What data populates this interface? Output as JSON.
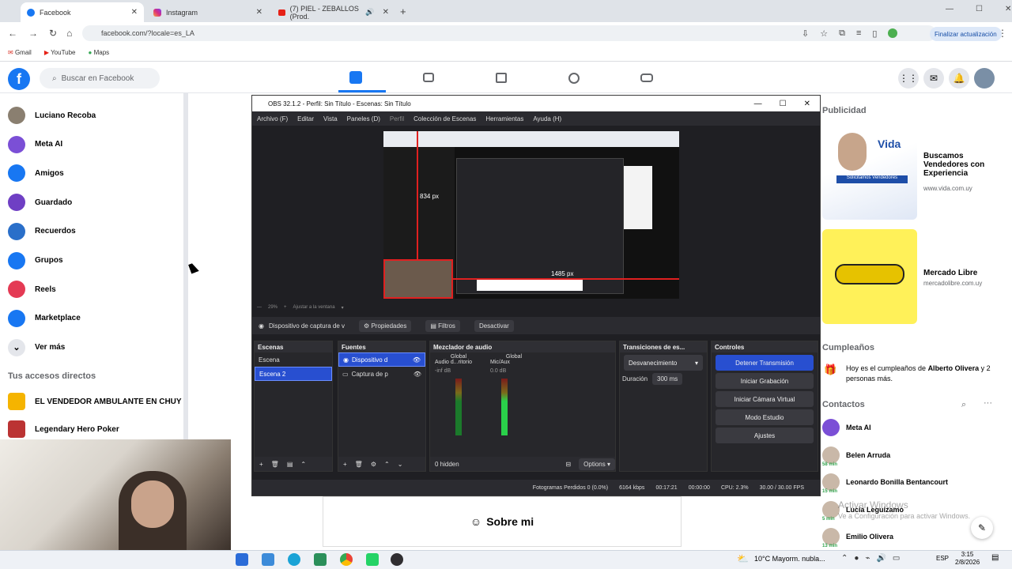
{
  "browser": {
    "tabs": [
      {
        "label": "Facebook",
        "active": true
      },
      {
        "label": "Instagram",
        "active": false
      },
      {
        "label": "(7) PIEL - ZEBALLOS (Prod.",
        "active": false
      }
    ],
    "url": "facebook.com/?locale=es_LA",
    "update_button": "Finalizar actualización",
    "bookmarks": [
      "Gmail",
      "YouTube",
      "Maps"
    ]
  },
  "facebook": {
    "search_placeholder": "Buscar en Facebook",
    "left_nav": [
      {
        "label": "Luciano Recoba",
        "icon": "avatar",
        "color": "#8a7f70"
      },
      {
        "label": "Meta AI",
        "icon": "meta-ai-icon",
        "color": "#7b4fd6"
      },
      {
        "label": "Amigos",
        "icon": "friends-icon",
        "color": "#1877f2"
      },
      {
        "label": "Guardado",
        "icon": "bookmark-icon",
        "color": "#6f3fc4"
      },
      {
        "label": "Recuerdos",
        "icon": "clock-icon",
        "color": "#2a6fc9"
      },
      {
        "label": "Grupos",
        "icon": "groups-icon",
        "color": "#1877f2"
      },
      {
        "label": "Reels",
        "icon": "reels-icon",
        "color": "#e43a54"
      },
      {
        "label": "Marketplace",
        "icon": "marketplace-icon",
        "color": "#1877f2"
      },
      {
        "label": "Ver más",
        "icon": "chevron-down-icon",
        "color": "#e4e6eb"
      }
    ],
    "shortcuts_title": "Tus accesos directos",
    "shortcuts": [
      {
        "label": "EL VENDEDOR AMBULANTE EN CHUY"
      },
      {
        "label": "Legendary Hero Poker"
      }
    ],
    "ads_title": "Publicidad",
    "ads": [
      {
        "title": "Buscamos Vendedores con Experiencia",
        "domain": "www.vida.com.uy",
        "banner": "Solicitamos Vendedores",
        "brand": "Vida"
      },
      {
        "title": "Mercado Libre",
        "domain": "mercadolibre.com.uy"
      }
    ],
    "birthdays_title": "Cumpleaños",
    "birthday_text_pre": "Hoy es el cumpleaños de ",
    "birthday_name": "Alberto Olivera",
    "birthday_text_post": " y 2 personas más.",
    "contacts_title": "Contactos",
    "contacts": [
      {
        "name": "Meta AI",
        "badge": ""
      },
      {
        "name": "Belen Arruda",
        "badge": "58 min"
      },
      {
        "name": "Leonardo Bonilla Bentancourt",
        "badge": "15 min"
      },
      {
        "name": "Lucia Leguizamo",
        "badge": "5 min"
      },
      {
        "name": "Emilio Olivera",
        "badge": "13 min"
      }
    ],
    "sobre_mi": "Sobre mi"
  },
  "obs": {
    "title": "OBS 32.1.2 - Perfil: Sin Título - Escenas: Sin Título",
    "menu": [
      "Archivo (F)",
      "Editar",
      "Vista",
      "Paneles (D)",
      "Perfil",
      "Colección de Escenas",
      "Herramientas",
      "Ayuda (H)"
    ],
    "preview_labels": {
      "px1": "834 px",
      "px2": "1485 px"
    },
    "zoom": "29%",
    "fit_label": "Ajustar a la ventana",
    "source_selected": "Dispositivo de captura de v",
    "source_bar_buttons": [
      "Propiedades",
      "Filtros",
      "Desactivar"
    ],
    "scenes_title": "Escenas",
    "scenes": [
      "Escena",
      "Escena 2"
    ],
    "sources_title": "Fuentes",
    "sources": [
      "Dispositivo d",
      "Captura de p"
    ],
    "mixer_title": "Mezclador de audio",
    "mixer_channels": [
      {
        "label": "Audio d...ritorio",
        "sublabel": "Global",
        "db": "-inf dB"
      },
      {
        "label": "Mic/Aux",
        "sublabel": "Global",
        "db": "0.0 dB"
      }
    ],
    "mixer_hidden": "0 hidden",
    "mixer_options": "Options",
    "transitions_title": "Transiciones de es...",
    "transition": "Desvanecimiento",
    "duration_label": "Duración",
    "duration_value": "300 ms",
    "controls_title": "Controles",
    "controls": [
      "Detener Transmisión",
      "Iniciar Grabación",
      "Iniciar Cámara Virtual",
      "Modo Estudio",
      "Ajustes"
    ],
    "status": {
      "dropped": "Fotogramas Perdidos 0 (0.0%)",
      "bitrate": "6164 kbps",
      "stream_time": "00:17:21",
      "rec_time": "00:00:00",
      "cpu": "CPU: 2.3%",
      "fps": "30.00 / 30.00 FPS"
    }
  },
  "windows": {
    "activate_title": "Activar Windows",
    "activate_sub": "Ve a Configuración para activar Windows.",
    "weather": "10°C Mayorm. nubla...",
    "lang": "ESP",
    "time": "3:15",
    "date": "2/8/2026"
  }
}
